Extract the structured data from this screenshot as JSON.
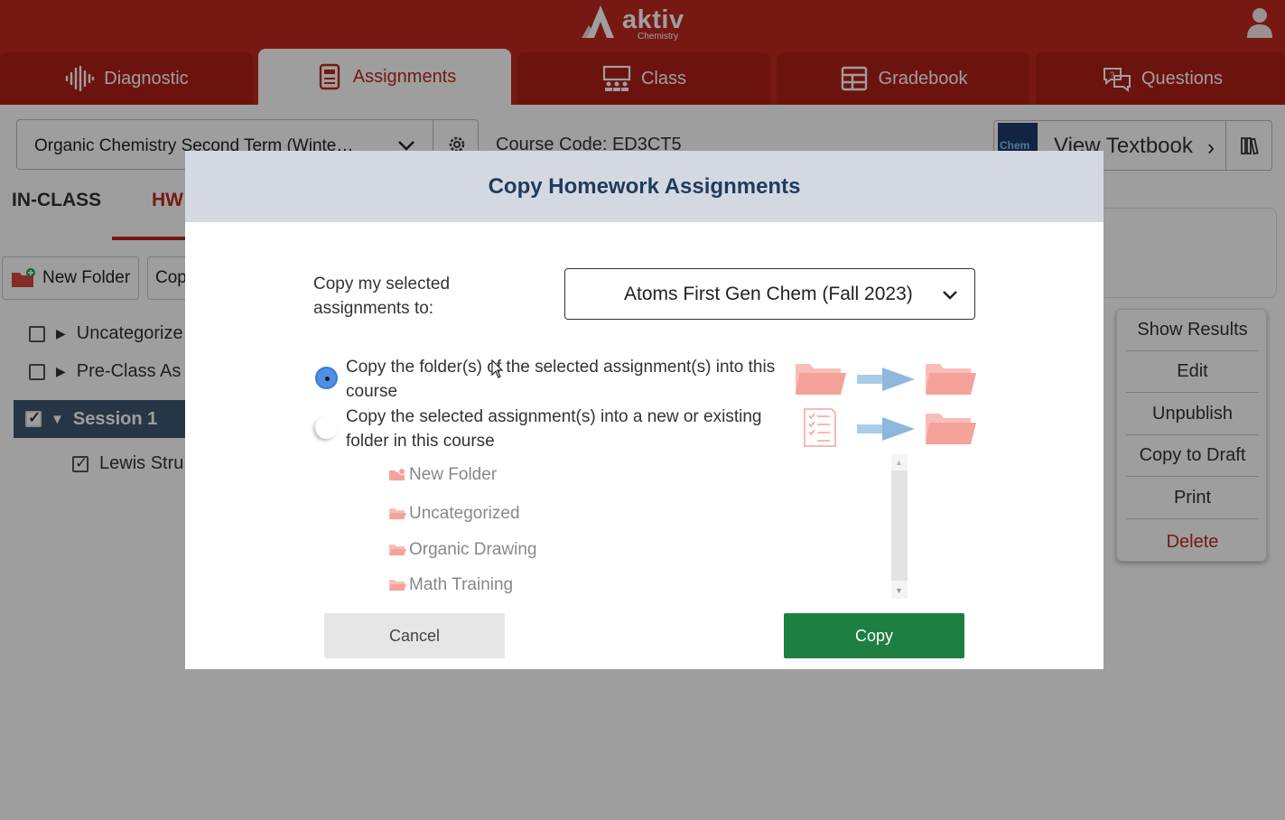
{
  "app": {
    "logo_word": "aktiv",
    "logo_sub": "Chemistry"
  },
  "nav": {
    "tabs": [
      {
        "label": "Diagnostic",
        "icon": "waveform-icon"
      },
      {
        "label": "Assignments",
        "icon": "document-icon",
        "active": true
      },
      {
        "label": "Class",
        "icon": "classroom-icon"
      },
      {
        "label": "Gradebook",
        "icon": "table-icon"
      },
      {
        "label": "Questions",
        "icon": "chat-bubbles-icon"
      }
    ]
  },
  "toolbar": {
    "course_select": "Organic Chemistry Second Term (Winte…",
    "course_code": "Course Code: ED3CT5",
    "textbook_cover": "Chem",
    "textbook_label": "View Textbook"
  },
  "subtabs": {
    "in_class": "IN-CLASS",
    "hw": "HW"
  },
  "actions": {
    "new_folder": "New Folder",
    "copy": "Cop"
  },
  "tree": {
    "items": [
      "Uncategorize",
      "Pre-Class As"
    ],
    "session": "Session 1",
    "assignment": "Lewis Stru"
  },
  "context_menu": [
    "Show Results",
    "Edit",
    "Unpublish",
    "Copy to Draft",
    "Print",
    "Delete"
  ],
  "modal": {
    "title": "Copy Homework Assignments",
    "copy_to_label": "Copy my selected assignments to:",
    "target_course": "Atoms First Gen Chem (Fall 2023)",
    "option1": "Copy the folder(s) of the selected assignment(s) into this course",
    "option2": "Copy the selected assignment(s) into a new or existing folder in this course",
    "folders": [
      "New Folder",
      "Uncategorized",
      "Organic Drawing",
      "Math Training"
    ],
    "cancel": "Cancel",
    "copy": "Copy"
  },
  "colors": {
    "brand_red": "#c0281e",
    "session_bg": "#3f5872",
    "copy_green": "#1d7f41",
    "radio_blue": "#4f8fe6",
    "folder_pink": "#f4a29a"
  }
}
